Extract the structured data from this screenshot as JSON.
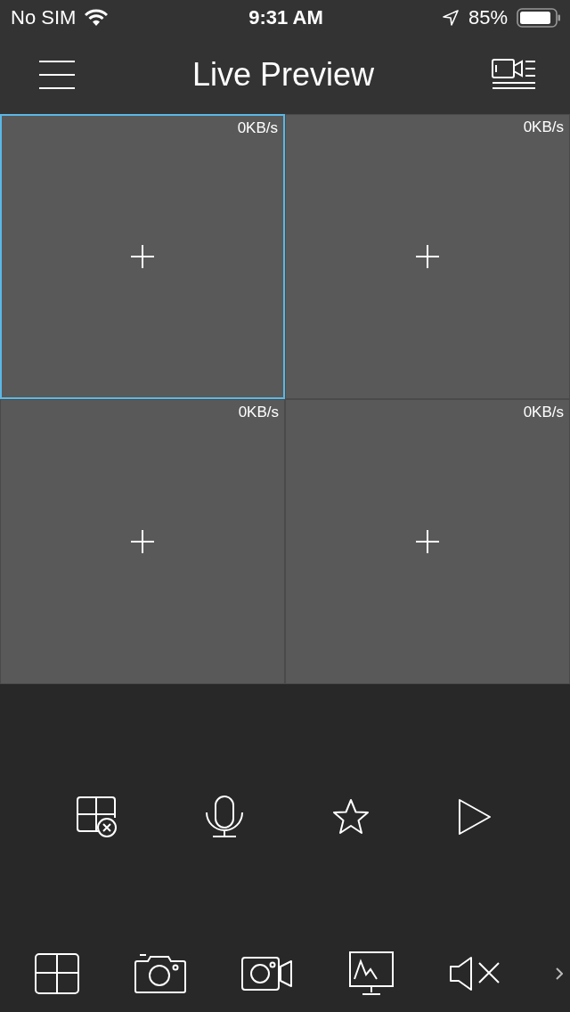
{
  "status_bar": {
    "carrier": "No SIM",
    "time": "9:31 AM",
    "battery": "85%"
  },
  "header": {
    "title": "Live Preview"
  },
  "tiles": [
    {
      "rate": "0KB/s",
      "selected": true
    },
    {
      "rate": "0KB/s",
      "selected": false
    },
    {
      "rate": "0KB/s",
      "selected": false
    },
    {
      "rate": "0KB/s",
      "selected": false
    }
  ]
}
